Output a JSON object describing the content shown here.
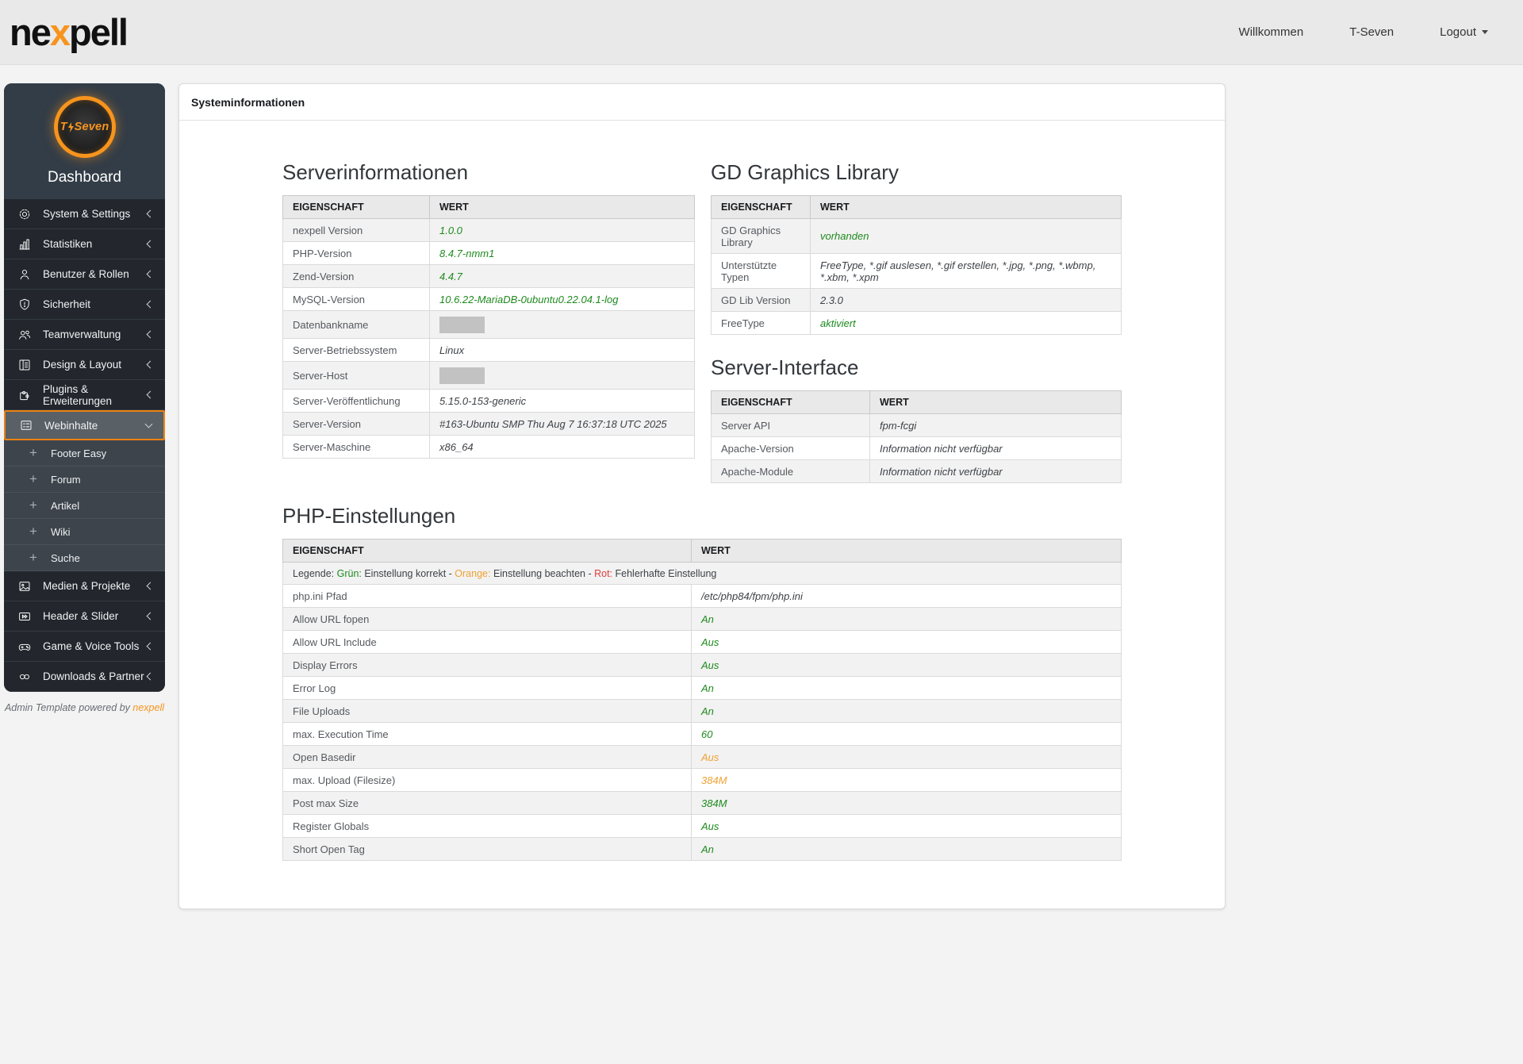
{
  "colors": {
    "brand_orange": "#f7941d",
    "active_border": "#ec8212",
    "status_green": "#1e8a1e",
    "status_orange": "#efa233",
    "status_red": "#e03c3c"
  },
  "header": {
    "logo_ne": "ne",
    "logo_x": "x",
    "logo_pell": "pell",
    "links": {
      "welcome": "Willkommen",
      "user": "T-Seven",
      "logout": "Logout"
    }
  },
  "sidebar": {
    "badge_t": "T",
    "badge_seven": "Seven",
    "title": "Dashboard",
    "plus_glyph": "+",
    "items": [
      {
        "label": "System & Settings"
      },
      {
        "label": "Statistiken"
      },
      {
        "label": "Benutzer & Rollen"
      },
      {
        "label": "Sicherheit"
      },
      {
        "label": "Teamverwaltung"
      },
      {
        "label": "Design & Layout"
      },
      {
        "label": "Plugins & Erweiterungen"
      },
      {
        "label": "Webinhalte"
      }
    ],
    "subitems": [
      {
        "label": "Footer Easy"
      },
      {
        "label": "Forum"
      },
      {
        "label": "Artikel"
      },
      {
        "label": "Wiki"
      },
      {
        "label": "Suche"
      }
    ],
    "items2": [
      {
        "label": "Medien & Projekte"
      },
      {
        "label": "Header & Slider"
      },
      {
        "label": "Game & Voice Tools"
      },
      {
        "label": "Downloads & Partner"
      }
    ],
    "footer_text": "Admin Template powered by",
    "footer_brand": "nexpell"
  },
  "main": {
    "card_title": "Systeminformationen",
    "table_headers": {
      "property": "EIGENSCHAFT",
      "value": "WERT"
    },
    "serverinfo": {
      "title": "Serverinformationen",
      "rows": [
        {
          "label": "nexpell Version",
          "value": "1.0.0",
          "status": "green"
        },
        {
          "label": "PHP-Version",
          "value": "8.4.7-nmm1",
          "status": "green"
        },
        {
          "label": "Zend-Version",
          "value": "4.4.7",
          "status": "green"
        },
        {
          "label": "MySQL-Version",
          "value": "10.6.22-MariaDB-0ubuntu0.22.04.1-log",
          "status": "green"
        },
        {
          "label": "Datenbankname",
          "redacted": true
        },
        {
          "label": "Server-Betriebssystem",
          "value": "Linux",
          "status": "plain"
        },
        {
          "label": "Server-Host",
          "redacted": true
        },
        {
          "label": "Server-Veröffentlichung",
          "value": "5.15.0-153-generic",
          "status": "plain"
        },
        {
          "label": "Server-Version",
          "value": "#163-Ubuntu SMP Thu Aug 7 16:37:18 UTC 2025",
          "status": "plain"
        },
        {
          "label": "Server-Maschine",
          "value": "x86_64",
          "status": "plain"
        }
      ]
    },
    "gd": {
      "title": "GD Graphics Library",
      "rows": [
        {
          "label": "GD Graphics Library",
          "value": "vorhanden",
          "status": "green"
        },
        {
          "label": "Unterstützte Typen",
          "value": "FreeType, *.gif auslesen, *.gif erstellen, *.jpg, *.png, *.wbmp, *.xbm, *.xpm",
          "status": "plain"
        },
        {
          "label": "GD Lib Version",
          "value": "2.3.0",
          "status": "plain"
        },
        {
          "label": "FreeType",
          "value": "aktiviert",
          "status": "green"
        }
      ]
    },
    "interface": {
      "title": "Server-Interface",
      "rows": [
        {
          "label": "Server API",
          "value": "fpm-fcgi",
          "status": "plain"
        },
        {
          "label": "Apache-Version",
          "value": "Information nicht verfügbar",
          "status": "plain"
        },
        {
          "label": "Apache-Module",
          "value": "Information nicht verfügbar",
          "status": "plain"
        }
      ]
    },
    "php": {
      "title": "PHP-Einstellungen",
      "legend": {
        "intro": "Legende: ",
        "green_label": "Grün:",
        "green_text": " Einstellung korrekt - ",
        "orange_label": "Orange:",
        "orange_text": " Einstellung beachten - ",
        "red_label": "Rot:",
        "red_text": " Fehlerhafte Einstellung"
      },
      "rows": [
        {
          "label": "php.ini Pfad",
          "value": "/etc/php84/fpm/php.ini",
          "status": "plain"
        },
        {
          "label": "Allow URL fopen",
          "value": "An",
          "status": "green"
        },
        {
          "label": "Allow URL Include",
          "value": "Aus",
          "status": "green"
        },
        {
          "label": "Display Errors",
          "value": "Aus",
          "status": "green"
        },
        {
          "label": "Error Log",
          "value": "An",
          "status": "green"
        },
        {
          "label": "File Uploads",
          "value": "An",
          "status": "green"
        },
        {
          "label": "max. Execution Time",
          "value": "60",
          "status": "green"
        },
        {
          "label": "Open Basedir",
          "value": "Aus",
          "status": "orange"
        },
        {
          "label": "max. Upload (Filesize)",
          "value": "384M",
          "status": "orange"
        },
        {
          "label": "Post max Size",
          "value": "384M",
          "status": "green"
        },
        {
          "label": "Register Globals",
          "value": "Aus",
          "status": "green"
        },
        {
          "label": "Short Open Tag",
          "value": "An",
          "status": "green"
        }
      ]
    }
  }
}
